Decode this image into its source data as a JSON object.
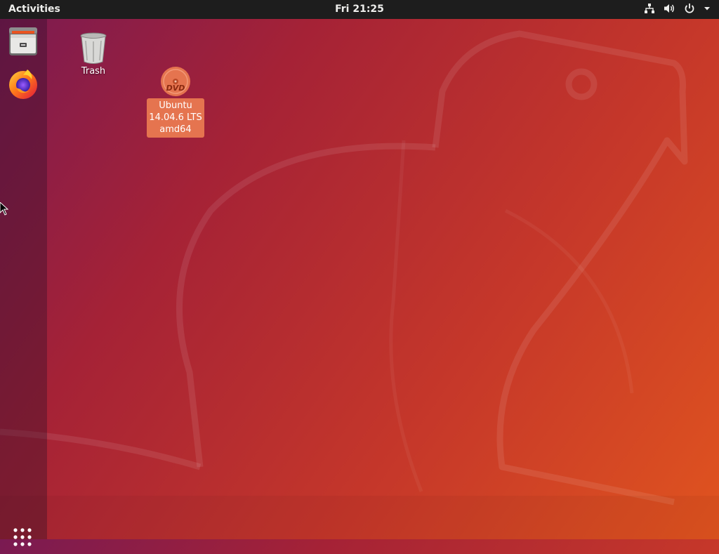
{
  "topbar": {
    "activities_label": "Activities",
    "clock": "Fri 21:25",
    "tray_icons": [
      "network-icon",
      "volume-icon",
      "power-icon",
      "menu-arrow-icon"
    ],
    "background_color": "#1d1d1d",
    "text_color": "#eeeeec"
  },
  "dock": {
    "items": [
      {
        "name": "files",
        "icon": "file-cabinet-icon"
      },
      {
        "name": "firefox",
        "icon": "firefox-icon"
      }
    ],
    "show_apps_icon": "grid-dots-icon"
  },
  "desktop": {
    "icons": [
      {
        "name": "trash",
        "label": "Trash",
        "icon": "trash-icon"
      },
      {
        "name": "dvd",
        "label_lines": [
          "Ubuntu",
          "14.04.6 LTS",
          "amd64"
        ],
        "icon": "dvd-icon",
        "selected": true
      }
    ],
    "selection_color": "#e5744f"
  },
  "wallpaper": {
    "colors": [
      "#7a1a52",
      "#a52236",
      "#c5372a",
      "#e0541f"
    ]
  }
}
